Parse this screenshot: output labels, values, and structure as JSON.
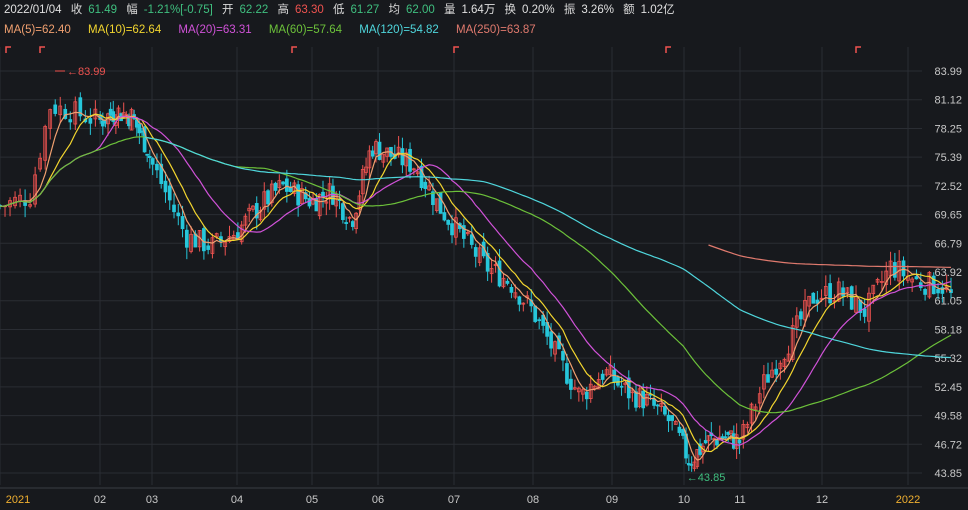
{
  "header": {
    "date": "2022/01/04",
    "close_label": "收",
    "close": "61.49",
    "change_label": "幅",
    "change": "-1.21%[-0.75]",
    "open_label": "开",
    "open": "62.22",
    "high_label": "高",
    "high": "63.30",
    "low_label": "低",
    "low": "61.27",
    "avg_label": "均",
    "avg": "62.00",
    "volume_label": "量",
    "volume": "1.64万",
    "turnover_label": "换",
    "turnover": "0.20%",
    "amplitude_label": "振",
    "amplitude": "3.26%",
    "amount_label": "额",
    "amount": "1.02亿"
  },
  "ma_legend": [
    {
      "text": "MA(5)=62.40",
      "color": "#f0a070"
    },
    {
      "text": "MA(10)=62.64",
      "color": "#f2d52f"
    },
    {
      "text": "MA(20)=63.31",
      "color": "#d052d8"
    },
    {
      "text": "MA(60)=57.64",
      "color": "#6cc13a"
    },
    {
      "text": "MA(120)=54.82",
      "color": "#4fd6dc"
    },
    {
      "text": "MA(250)=63.87",
      "color": "#e07a6e"
    }
  ],
  "chart_data": {
    "type": "candlestick",
    "y_ticks": [
      "83.99",
      "81.12",
      "78.25",
      "75.39",
      "72.52",
      "69.65",
      "66.79",
      "63.92",
      "61.05",
      "58.18",
      "55.32",
      "52.45",
      "49.58",
      "46.72",
      "43.85"
    ],
    "x_ticks": [
      "2021",
      "02",
      "03",
      "04",
      "05",
      "06",
      "07",
      "08",
      "09",
      "10",
      "11",
      "12",
      "2022"
    ],
    "ylim": [
      43.85,
      83.99
    ],
    "high_marker": "83.99",
    "low_marker": "43.85",
    "up_color": "#ef5350",
    "down_color": "#26c6da",
    "close_series": [
      {
        "m": 0.0,
        "v": 70.5
      },
      {
        "m": 0.3,
        "v": 71.5
      },
      {
        "m": 0.5,
        "v": 80.5
      },
      {
        "m": 0.7,
        "v": 80.0
      },
      {
        "m": 1.0,
        "v": 79.0
      },
      {
        "m": 1.3,
        "v": 80.0
      },
      {
        "m": 1.6,
        "v": 79.5
      },
      {
        "m": 1.9,
        "v": 76.5
      },
      {
        "m": 2.1,
        "v": 73.0
      },
      {
        "m": 2.4,
        "v": 67.5
      },
      {
        "m": 2.7,
        "v": 66.5
      },
      {
        "m": 3.0,
        "v": 68.0
      },
      {
        "m": 3.3,
        "v": 70.5
      },
      {
        "m": 3.6,
        "v": 72.5
      },
      {
        "m": 4.0,
        "v": 71.0
      },
      {
        "m": 4.3,
        "v": 72.0
      },
      {
        "m": 4.6,
        "v": 69.0
      },
      {
        "m": 4.9,
        "v": 76.5
      },
      {
        "m": 5.2,
        "v": 75.5
      },
      {
        "m": 5.5,
        "v": 74.5
      },
      {
        "m": 5.8,
        "v": 70.5
      },
      {
        "m": 6.1,
        "v": 67.5
      },
      {
        "m": 6.4,
        "v": 64.5
      },
      {
        "m": 6.7,
        "v": 63.0
      },
      {
        "m": 7.0,
        "v": 60.0
      },
      {
        "m": 7.3,
        "v": 55.5
      },
      {
        "m": 7.6,
        "v": 51.5
      },
      {
        "m": 7.9,
        "v": 54.0
      },
      {
        "m": 8.2,
        "v": 52.0
      },
      {
        "m": 8.5,
        "v": 51.0
      },
      {
        "m": 8.8,
        "v": 49.0
      },
      {
        "m": 9.1,
        "v": 45.0
      },
      {
        "m": 9.4,
        "v": 47.0
      },
      {
        "m": 9.7,
        "v": 47.5
      },
      {
        "m": 10.0,
        "v": 47.0
      },
      {
        "m": 10.3,
        "v": 53.0
      },
      {
        "m": 10.6,
        "v": 57.0
      },
      {
        "m": 10.9,
        "v": 61.5
      },
      {
        "m": 11.2,
        "v": 62.0
      },
      {
        "m": 11.5,
        "v": 60.0
      },
      {
        "m": 11.8,
        "v": 64.5
      },
      {
        "m": 12.1,
        "v": 63.0
      },
      {
        "m": 12.4,
        "v": 62.5
      },
      {
        "m": 12.5,
        "v": 61.5
      }
    ]
  }
}
